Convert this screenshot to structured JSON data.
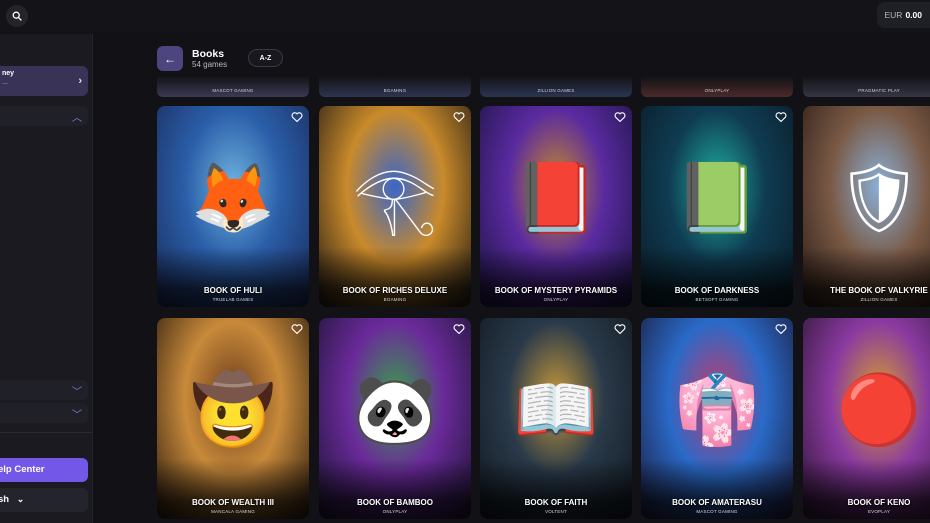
{
  "topbar": {
    "search_icon": "search-icon",
    "balance_currency": "EUR",
    "balance_amount": "0.00"
  },
  "sidebar": {
    "active_item_label": "ney",
    "active_item_sub": "...",
    "help_label": "elp Center",
    "language_label": "sh"
  },
  "header": {
    "title": "Books",
    "count": "54 games",
    "sort_label": "A-Z"
  },
  "peek_row": [
    {
      "provider": "MASCOT GAMING",
      "color": "#3a3a55"
    },
    {
      "provider": "BGAMING",
      "color": "#2e3550"
    },
    {
      "provider": "ZILLION GAMES",
      "color": "#2a3550"
    },
    {
      "provider": "ONLYPLAY",
      "color": "#4a2a2a"
    },
    {
      "provider": "PRAGMATIC PLAY",
      "color": "#353545"
    }
  ],
  "games": [
    {
      "name": "BOOK OF HULI",
      "provider": "TRUELAB GAMES",
      "colors": [
        "#2a5ea8",
        "#6fb3e0",
        "#1b2a5a"
      ],
      "glyph": "🦊"
    },
    {
      "name": "BOOK OF RICHES DELUXE",
      "provider": "BGAMING",
      "colors": [
        "#c98a2a",
        "#3a66c8",
        "#201a14"
      ],
      "glyph": "𓂀"
    },
    {
      "name": "BOOK OF MYSTERY PYRAMIDS",
      "provider": "ONLYPLAY",
      "colors": [
        "#5a2aa0",
        "#c88a2a",
        "#1a1440"
      ],
      "glyph": "📕"
    },
    {
      "name": "BOOK OF DARKNESS",
      "provider": "BETSOFT GAMING",
      "colors": [
        "#0f3c52",
        "#1fb0a0",
        "#0a1a26"
      ],
      "glyph": "📗"
    },
    {
      "name": "THE BOOK OF VALKYRIE",
      "provider": "ZILLION GAMES",
      "colors": [
        "#7a5a46",
        "#8ab0d8",
        "#2a1a14"
      ],
      "glyph": "🛡"
    },
    {
      "name": "BOOK OF WEALTH III",
      "provider": "MANCALA GAMING",
      "colors": [
        "#c88a3a",
        "#6a3a1a",
        "#2a1a0e"
      ],
      "glyph": "🤠"
    },
    {
      "name": "BOOK OF BAMBOO",
      "provider": "ONLYPLAY",
      "colors": [
        "#6a2a9a",
        "#3aa04a",
        "#1a1430"
      ],
      "glyph": "🐼"
    },
    {
      "name": "BOOK OF FAITH",
      "provider": "VOLTENT",
      "colors": [
        "#2a3a4a",
        "#c89a3a",
        "#101820"
      ],
      "glyph": "📖"
    },
    {
      "name": "BOOK OF AMATERASU",
      "provider": "MASCOT GAMING",
      "colors": [
        "#2a6ac8",
        "#c83a6a",
        "#1a1a3a"
      ],
      "glyph": "👘"
    },
    {
      "name": "BOOK OF KENO",
      "provider": "EVOPLAY",
      "colors": [
        "#8a3aa0",
        "#d8a02a",
        "#2a1430"
      ],
      "glyph": "🔴"
    }
  ]
}
